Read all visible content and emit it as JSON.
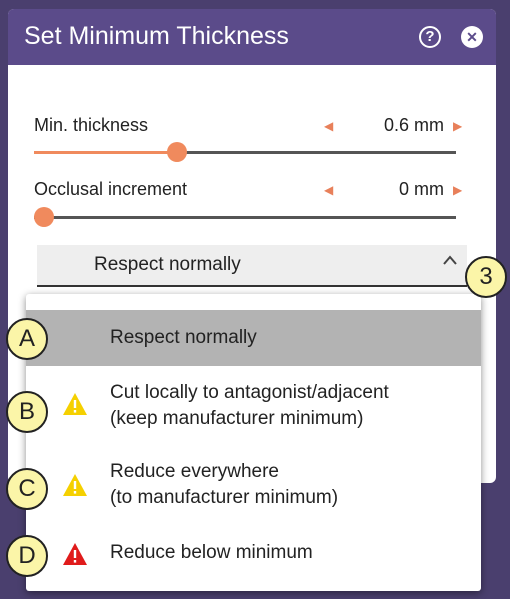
{
  "dialog": {
    "title": "Set Minimum Thickness",
    "help_icon": "?",
    "close_icon": "✕"
  },
  "sliders": [
    {
      "label": "Min. thickness",
      "value": "0.6 mm",
      "fraction": 0.34
    },
    {
      "label": "Occlusal increment",
      "value": "0 mm",
      "fraction": 0.0
    }
  ],
  "dropdown": {
    "selected": "Respect normally",
    "chevron": "^",
    "options": [
      {
        "line1": "Respect normally",
        "line2": "",
        "icon": "none",
        "callout": "A",
        "selected": true
      },
      {
        "line1": "Cut locally to antagonist/adjacent",
        "line2": "(keep manufacturer minimum)",
        "icon": "warning-yellow",
        "callout": "B",
        "selected": false
      },
      {
        "line1": "Reduce everywhere",
        "line2": "(to manufacturer minimum)",
        "icon": "warning-yellow",
        "callout": "C",
        "selected": false
      },
      {
        "line1": "Reduce below minimum",
        "line2": "",
        "icon": "warning-red",
        "callout": "D",
        "selected": false
      }
    ]
  },
  "callouts": {
    "dropdown": "3"
  },
  "colors": {
    "background": "#4a3f6e",
    "titlebar": "#5b4b8a",
    "slider_accent": "#f08a5d",
    "selected_option": "#b3b3b3",
    "warning_yellow": "#f5d000",
    "warning_red": "#e01b1b",
    "callout_fill": "#fbf5a8"
  }
}
